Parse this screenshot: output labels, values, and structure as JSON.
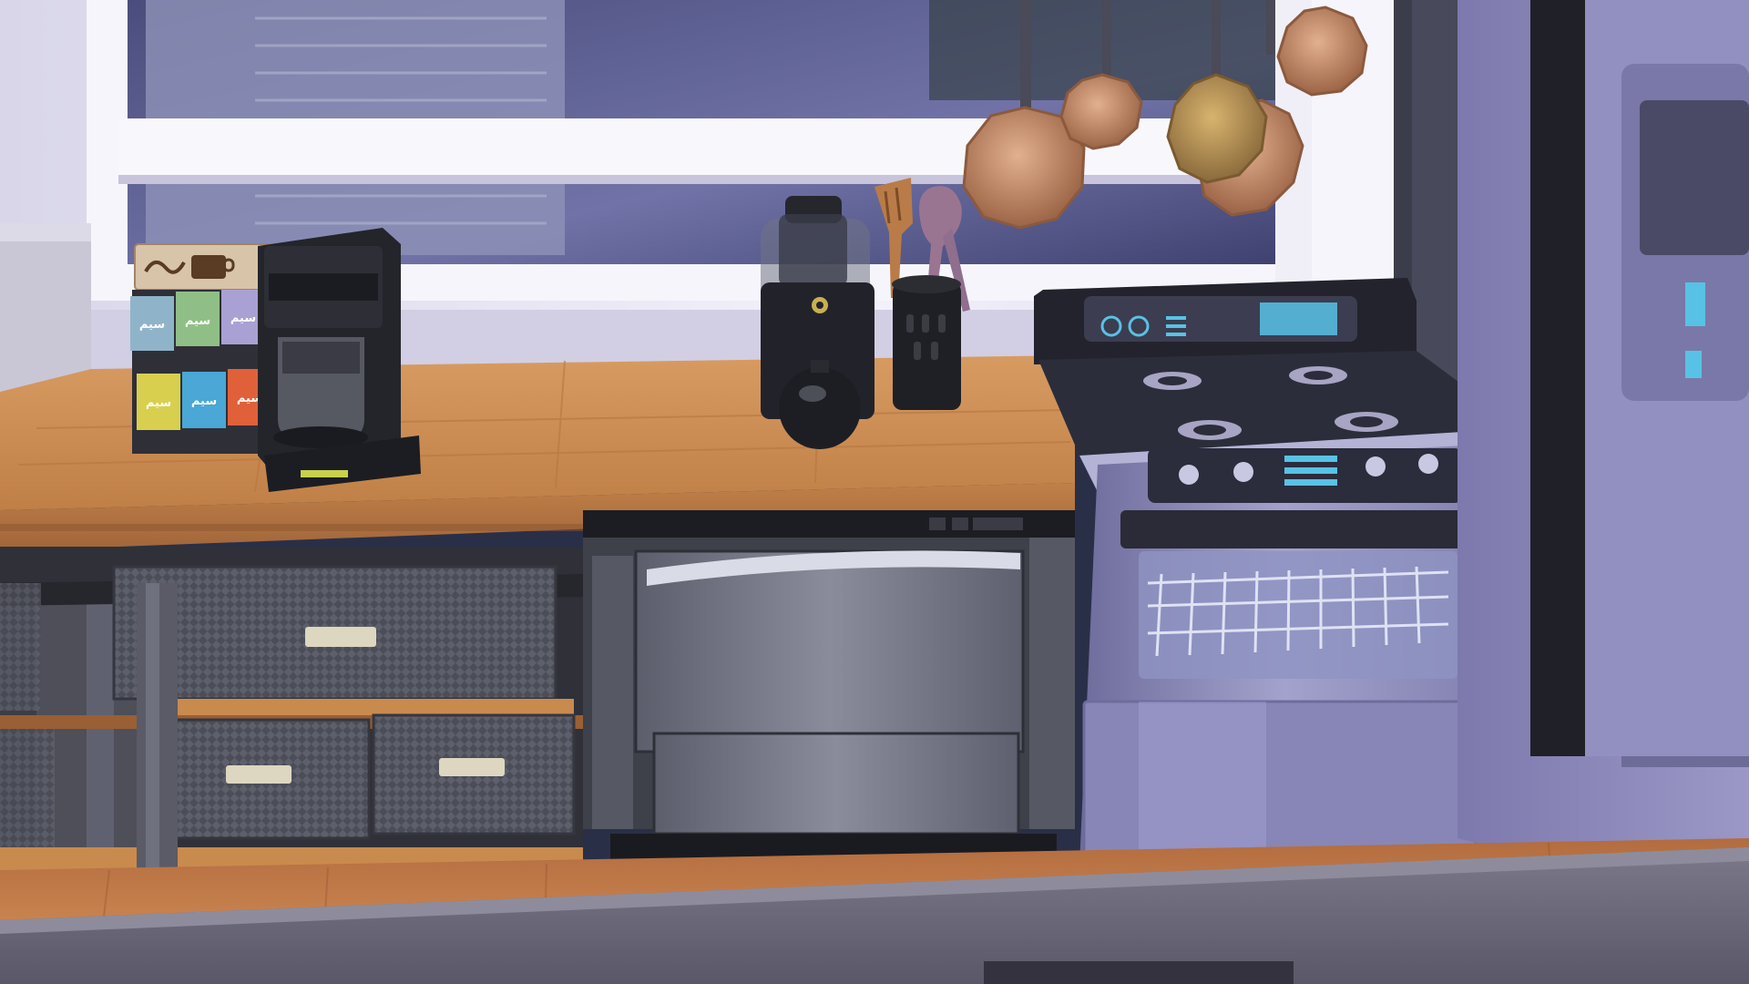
{
  "scene": {
    "type": "kitchen-counter-closeup",
    "objects": [
      "window",
      "tea-box-rack",
      "coffee-maker",
      "coffee-grinder",
      "utensil-holder",
      "hanging-pans",
      "electric-stove",
      "dishwasher",
      "mesh-drawers",
      "refrigerator",
      "butcher-block-counter"
    ]
  },
  "palette": {
    "wall": "#e6e2f2",
    "window_glass": "#6b6f9e",
    "counter_wood": "#c98a4e",
    "counter_edge": "#a96b3a",
    "floor_wood": "#c97d4a",
    "appliance_black": "#1e1f24",
    "stove_steel": "#8a89b8",
    "stove_top": "#2c2d3a",
    "copper": "#b9805c",
    "fridge": "#8a86b8",
    "display_cyan": "#58c2e6",
    "coffee_display": "#c8d14a",
    "foreground_counter": "#6c6a7a"
  },
  "icons": {
    "stove_dials": "dial-icon",
    "burners": "burner-icon",
    "cup_sign": "coffee-cup-icon"
  },
  "tea_labels": [
    "سیم",
    "سیم",
    "سیم",
    "سیم",
    "سیم",
    "سیم"
  ]
}
